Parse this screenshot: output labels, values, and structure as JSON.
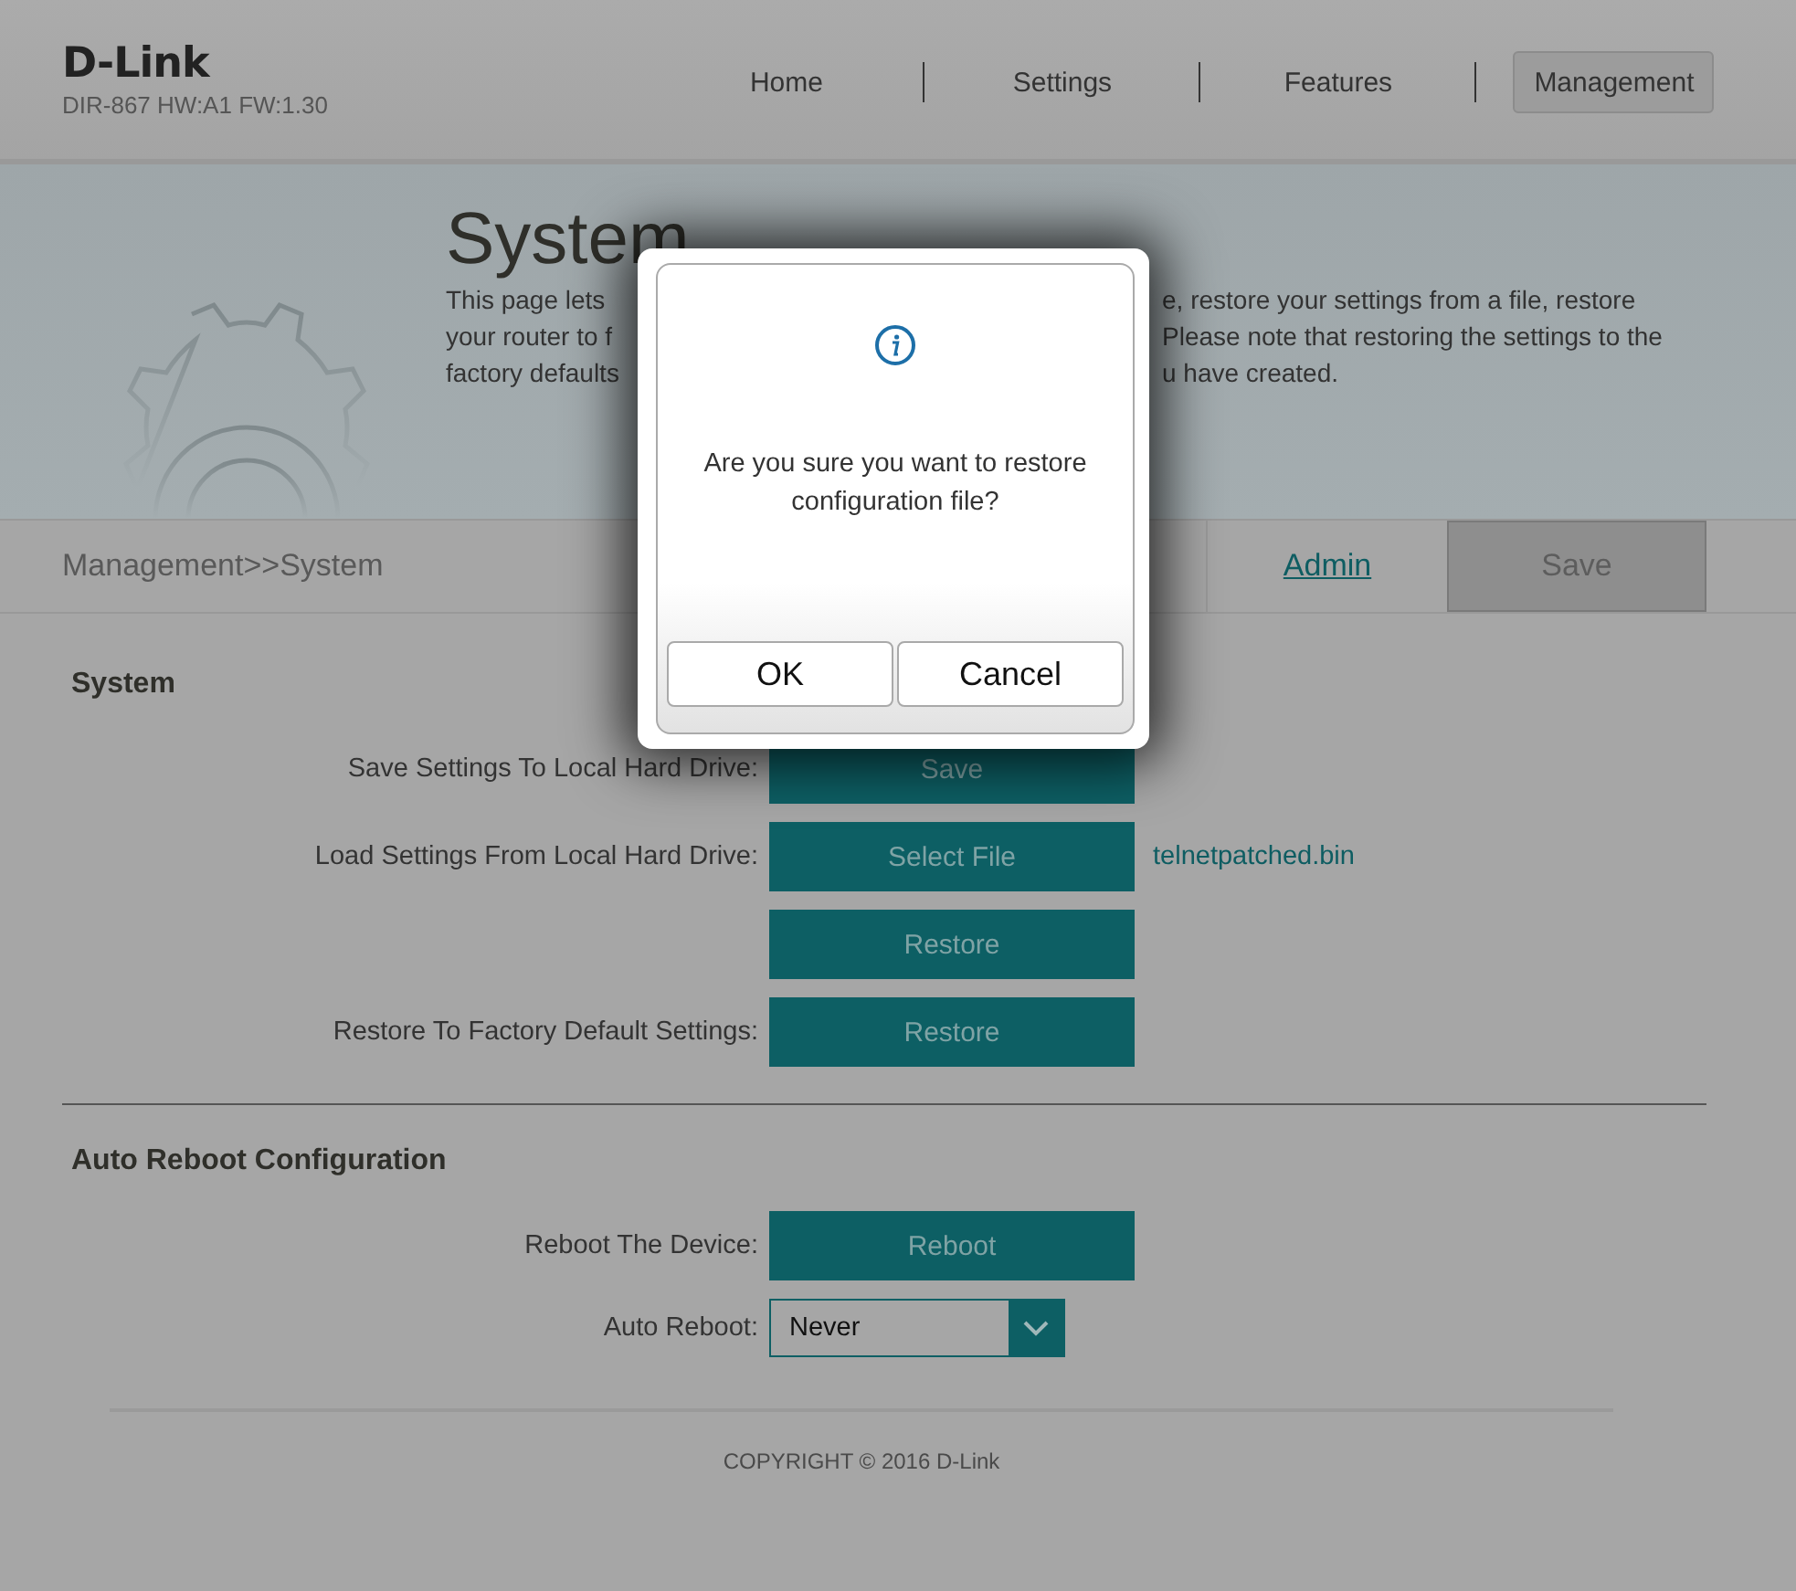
{
  "header": {
    "logo": "D-Link",
    "model": "DIR-867 HW:A1 FW:1.30",
    "nav": [
      {
        "label": "Home",
        "selected": false
      },
      {
        "label": "Settings",
        "selected": false
      },
      {
        "label": "Features",
        "selected": false
      },
      {
        "label": "Management",
        "selected": true
      }
    ]
  },
  "banner": {
    "title": "System",
    "description_lines": [
      {
        "left": "This page lets",
        "right": "e, restore your settings from a file, restore"
      },
      {
        "left": "your router to f",
        "right": "Please note that restoring the settings to the"
      },
      {
        "left": "factory defaults",
        "right": "u have created."
      }
    ]
  },
  "breadcrumb": "Management>>System",
  "actions": {
    "link": "Admin",
    "button": "Save"
  },
  "sections": [
    {
      "title": "System",
      "rows": [
        {
          "label": "Save Settings To Local Hard Drive:",
          "kind": "button",
          "button": "Save"
        },
        {
          "label": "Load Settings From Local Hard Drive:",
          "kind": "button",
          "button": "Select File",
          "file": "telnetpatched.bin"
        },
        {
          "kind": "button",
          "button": "Restore"
        },
        {
          "label": "Restore To Factory Default Settings:",
          "kind": "button",
          "button": "Restore"
        }
      ]
    },
    {
      "title": "Auto Reboot Configuration",
      "rows": [
        {
          "label": "Reboot The Device:",
          "kind": "button",
          "button": "Reboot"
        },
        {
          "label": "Auto Reboot:",
          "kind": "select",
          "value": "Never"
        }
      ]
    }
  ],
  "footer": "COPYRIGHT © 2016 D-Link",
  "dialog": {
    "message": "Are you sure you want to restore configuration file?",
    "buttons": [
      "OK",
      "Cancel"
    ]
  }
}
